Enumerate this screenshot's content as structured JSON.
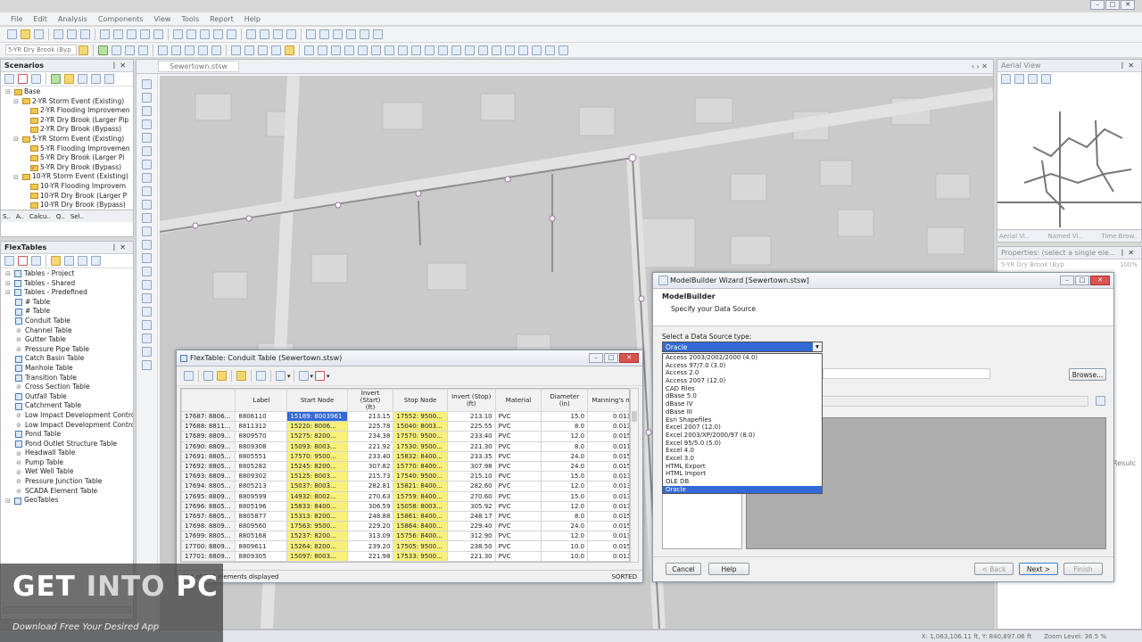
{
  "menu": [
    "File",
    "Edit",
    "Analysis",
    "Components",
    "View",
    "Tools",
    "Report",
    "Help"
  ],
  "toolbar": {
    "scenario_select": "5-YR Dry Brook (Byp"
  },
  "scenarios_pane": {
    "title": "Scenarios",
    "items": [
      {
        "label": "Base",
        "level": 0,
        "checked": false
      },
      {
        "label": "2-YR Storm Event (Existing)",
        "level": 1,
        "checked": false
      },
      {
        "label": "2-YR Flooding Improvemen",
        "level": 2,
        "checked": false
      },
      {
        "label": "2-YR Dry Brook (Larger Pip",
        "level": 2,
        "checked": false
      },
      {
        "label": "2-YR Dry Brook (Bypass)",
        "level": 2,
        "checked": false
      },
      {
        "label": "5-YR Storm Event (Existing)",
        "level": 1,
        "checked": false
      },
      {
        "label": "5-YR Flooding Improvemen",
        "level": 2,
        "checked": false
      },
      {
        "label": "5-YR Dry Brook (Larger Pi",
        "level": 2,
        "checked": false
      },
      {
        "label": "5-YR Dry Brook (Bypass)",
        "level": 2,
        "checked": true
      },
      {
        "label": "10-YR Storm Event (Existing)",
        "level": 1,
        "checked": false
      },
      {
        "label": "10-YR Flooding Improvem",
        "level": 2,
        "checked": false
      },
      {
        "label": "10-YR Dry Brook (Larger P",
        "level": 2,
        "checked": false
      },
      {
        "label": "10-YR Dry Brook (Bypass)",
        "level": 2,
        "checked": false
      }
    ],
    "tabs": [
      "S..",
      "A..",
      "Calcu..",
      "Q..",
      "Sel.."
    ]
  },
  "flextables_pane": {
    "title": "FlexTables",
    "items": [
      {
        "label": "Tables - Project",
        "level": 0,
        "kind": "tbl"
      },
      {
        "label": "Tables - Shared",
        "level": 0,
        "kind": "tbl"
      },
      {
        "label": "Tables - Predefined",
        "level": 0,
        "kind": "tbl"
      },
      {
        "label": "# Table",
        "level": 1,
        "kind": "tbl"
      },
      {
        "label": "# Table",
        "level": 1,
        "kind": "tbl"
      },
      {
        "label": "Conduit Table",
        "level": 1,
        "kind": "tbl"
      },
      {
        "label": "Channel Table",
        "level": 1,
        "kind": "sub"
      },
      {
        "label": "Gutter Table",
        "level": 1,
        "kind": "sub"
      },
      {
        "label": "Pressure Pipe Table",
        "level": 1,
        "kind": "sub"
      },
      {
        "label": "Catch Basin Table",
        "level": 1,
        "kind": "tbl"
      },
      {
        "label": "Manhole Table",
        "level": 1,
        "kind": "tbl"
      },
      {
        "label": "Transition Table",
        "level": 1,
        "kind": "tbl"
      },
      {
        "label": "Cross Section Table",
        "level": 1,
        "kind": "sub"
      },
      {
        "label": "Outfall Table",
        "level": 1,
        "kind": "tbl"
      },
      {
        "label": "Catchment Table",
        "level": 1,
        "kind": "tbl"
      },
      {
        "label": "Low Impact Development Control",
        "level": 1,
        "kind": "sub"
      },
      {
        "label": "Low Impact Development Control",
        "level": 1,
        "kind": "sub"
      },
      {
        "label": "Pond Table",
        "level": 1,
        "kind": "tbl"
      },
      {
        "label": "Pond Outlet Structure Table",
        "level": 1,
        "kind": "tbl"
      },
      {
        "label": "Headwall Table",
        "level": 1,
        "kind": "sub"
      },
      {
        "label": "Pump Table",
        "level": 1,
        "kind": "sub"
      },
      {
        "label": "Wet Well Table",
        "level": 1,
        "kind": "sub"
      },
      {
        "label": "Pressure Junction Table",
        "level": 1,
        "kind": "sub"
      },
      {
        "label": "SCADA Element Table",
        "level": 1,
        "kind": "sub"
      },
      {
        "label": "GeoTables",
        "level": 0,
        "kind": "tbl"
      }
    ]
  },
  "document_tab": "Sewertown.stsw",
  "aerial_view": {
    "title": "Aerial View",
    "tabs": [
      "Aerial Vi..",
      "Named Vi..",
      "Time Brow.."
    ]
  },
  "properties_pane": {
    "title": "Properties: (select a single ele...",
    "row_label": "5-YR Dry Brook (Byp",
    "row_value": "100%"
  },
  "flextable": {
    "title": "FlexTable: Conduit Table (Sewertown.stsw)",
    "columns": [
      "",
      "Label",
      "Start Node",
      "Invert (Start)\n(ft)",
      "Stop Node",
      "Invert (Stop)\n(ft)",
      "Material",
      "Diameter\n(in)",
      "Manning's n"
    ],
    "rows": [
      [
        "17687: 8806...",
        "8806110",
        "15189: 8003961",
        "213.15",
        "17552: 9500...",
        "213.10",
        "PVC",
        "15.0",
        "0.013"
      ],
      [
        "17688: 8811...",
        "8811312",
        "15220: 8006...",
        "225.78",
        "15040: 8003...",
        "225.55",
        "PVC",
        "8.0",
        "0.013"
      ],
      [
        "17689: 8809...",
        "8809570",
        "15275: 8200...",
        "234.38",
        "17570: 9500...",
        "233.40",
        "PVC",
        "12.0",
        "0.015"
      ],
      [
        "17690: 8809...",
        "8809308",
        "15093: 8003...",
        "221.92",
        "17530: 9500...",
        "221.30",
        "PVC",
        "8.0",
        "0.011"
      ],
      [
        "17691: 8805...",
        "8805551",
        "17570: 9500...",
        "233.40",
        "15832: 8400...",
        "233.35",
        "PVC",
        "24.0",
        "0.015"
      ],
      [
        "17692: 8805...",
        "8805282",
        "15245: 8200...",
        "307.82",
        "15770: 8400...",
        "307.98",
        "PVC",
        "24.0",
        "0.015"
      ],
      [
        "17693: 8809...",
        "8809302",
        "15125: 8003...",
        "215.73",
        "17540: 9500...",
        "215.10",
        "PVC",
        "15.0",
        "0.013"
      ],
      [
        "17694: 8805...",
        "8805213",
        "15037: 8003...",
        "282.81",
        "15821: 8400...",
        "282.60",
        "PVC",
        "12.0",
        "0.013"
      ],
      [
        "17695: 8809...",
        "8809599",
        "14932: 8002...",
        "270.63",
        "15759: 8400...",
        "270.60",
        "PVC",
        "15.0",
        "0.013"
      ],
      [
        "17696: 8805...",
        "8805196",
        "15833: 8400...",
        "306.59",
        "15058: 8003...",
        "305.92",
        "PVC",
        "12.0",
        "0.013"
      ],
      [
        "17697: 8805...",
        "8805877",
        "15313: 8200...",
        "248.88",
        "15861: 8400...",
        "248.17",
        "PVC",
        "8.0",
        "0.015"
      ],
      [
        "17698: 8809...",
        "8809560",
        "17563: 9500...",
        "229.20",
        "15864: 8400...",
        "229.40",
        "PVC",
        "24.0",
        "0.015"
      ],
      [
        "17699: 8805...",
        "8805168",
        "15237: 8200...",
        "313.09",
        "15756: 8400...",
        "312.90",
        "PVC",
        "12.0",
        "0.013"
      ],
      [
        "17700: 8809...",
        "8809611",
        "15264: 8200...",
        "239.20",
        "17505: 9500...",
        "238.50",
        "PVC",
        "10.0",
        "0.015"
      ],
      [
        "17701: 8809...",
        "8809305",
        "15097: 8003...",
        "221.98",
        "17533: 9500...",
        "221.30",
        "PVC",
        "10.0",
        "0.013"
      ]
    ],
    "status_left": "753 of 753 elements displayed",
    "status_right": "SORTED"
  },
  "wizard": {
    "title": "ModelBuilder Wizard [Sewertown.stsw]",
    "heading": "ModelBuilder",
    "subheading": "Specify your Data Source",
    "source_label": "Select a Data Source type:",
    "selected": "Oracle",
    "options": [
      "Access 2003/2002/2000 (4.0)",
      "Access 97/7.0 (3.0)",
      "Access 2.0",
      "Access 2007 (12.0)",
      "CAD Files",
      "dBase 5.0",
      "dBase IV",
      "dBase III",
      "Esri Shapefiles",
      "Excel 2007 (12.0)",
      "Excel 2003/XP/2000/97 (8.0)",
      "Excel 95/5.0 (5.0)",
      "Excel 4.0",
      "Excel 3.0",
      "HTML Export",
      "HTML Import",
      "OLE DB",
      "Oracle"
    ],
    "browse": "Browse...",
    "cancel": "Cancel",
    "help": "Help",
    "back": "< Back",
    "next": "Next >",
    "finish": "Finish"
  },
  "statusbar": {
    "coords": "X: 1,063,106.11 ft, Y: 840,897.06 ft",
    "zoom": "Zoom Level: 36.5 %"
  },
  "side_text": "Resulc",
  "watermark": {
    "title_a": "GET ",
    "title_b": "INTO",
    "title_c": " PC",
    "subtitle": "Download Free Your Desired App"
  }
}
